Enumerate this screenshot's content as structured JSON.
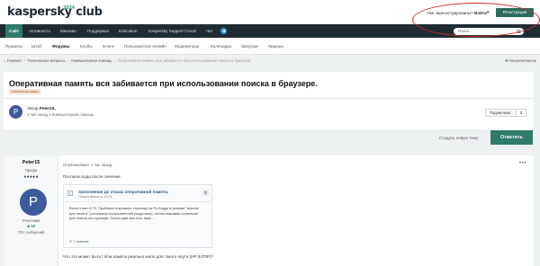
{
  "header": {
    "logo": "kaspersky club",
    "logo_year": "2024",
    "signin_prefix": "Уже зарегистрированы?",
    "signin_action": "Войти",
    "signin_caret": "▾",
    "register": "Регистрация"
  },
  "topnav": {
    "items": [
      "Сайт",
      "Активность",
      "Магазин",
      "Поддержка",
      "Education",
      "Kaspersky Support Forum",
      "Чат"
    ],
    "active_index": 0,
    "telegram_icon": "telegram-icon"
  },
  "search": {
    "placeholder": "Поиск...",
    "icon": "search-icon"
  },
  "subnav": {
    "items": [
      "Правила",
      "Штаб",
      "Форумы",
      "Клубы",
      "Блоги",
      "Пользователи онлайн",
      "Модераторы",
      "Календарь",
      "Загрузки",
      "Лидеры"
    ],
    "active_index": 2
  },
  "breadcrumb": {
    "items": [
      "Главная",
      "Технические вопросы",
      "Компьютерная помощь"
    ],
    "current": "Оперативная память вся забивается при использовании поиска в браузере.",
    "home_icon": "home-icon"
  },
  "unread_label": "Непрочитанное",
  "topic": {
    "title": "Оперативная память вся забивается при использовании поиска в браузере.",
    "tag": "оперативная память",
    "author_prefix": "Автор",
    "author": "Peter15,",
    "time": "1 час назад в Компьютерная помощь",
    "avatar_letter": "P",
    "subscribe_label": "Подписчики",
    "subscribe_count": "1"
  },
  "actions": {
    "new_topic": "Создать новую тему",
    "reply": "Ответить"
  },
  "post": {
    "author": "Peter15",
    "role": "Профи",
    "pips": "●●●●●",
    "avatar_letter": "P",
    "group": "Участники",
    "reputation": "◆ 18",
    "posts_count": "726 сообщений",
    "posted": "Опубликовано: 1 час назад",
    "menu": "•••",
    "body": "Послали сюда после лечения.",
    "quote": {
      "title": "Заполнение до отказа оперативной памяти.",
      "meta": "Пожаловался в 15:01",
      "text": "Всего стоит 8 Гб. Пробовал открывать страницу на Ру Борде в режиме \"версия для печати\" (остальные пользователей разделили), потом нажимаю сочетание для поиска на странице. Поиск идет все-ели, прас...",
      "replies": "7 ответов",
      "corner": "⧉",
      "replies_icon": "comment-icon"
    },
    "question": "Что это может быть? Или памяти реально мало для такого ноута (HP 8470P)?"
  },
  "colors": {
    "accent": "#2f7a69",
    "nav_dark": "#1f2d33",
    "avatar": "#3d5a9c",
    "annotation_red": "#cc2a2a"
  }
}
